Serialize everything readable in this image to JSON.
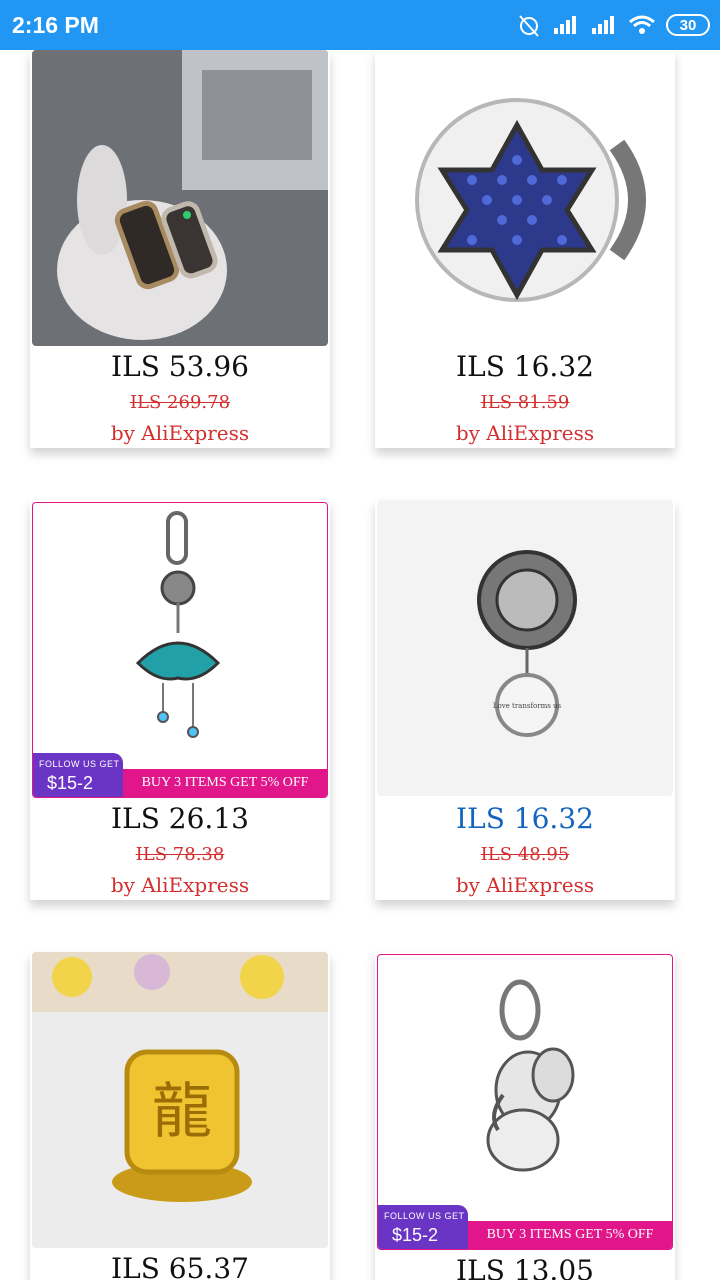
{
  "status_bar": {
    "time": "2:16 PM",
    "battery": "30"
  },
  "products": [
    {
      "price": "ILS 53.96",
      "old_price": "ILS 269.78",
      "seller": "by AliExpress",
      "highlight": false
    },
    {
      "price": "ILS 16.32",
      "old_price": "ILS 81.59",
      "seller": "by AliExpress",
      "highlight": false
    },
    {
      "price": "ILS 26.13",
      "old_price": "ILS 78.38",
      "seller": "by AliExpress",
      "highlight": false,
      "promo": {
        "follow": "FOLLOW US GET",
        "amount": "$15-2",
        "offer": "BUY 3 ITEMS GET 5% OFF"
      }
    },
    {
      "price": "ILS 16.32",
      "old_price": "ILS 48.95",
      "seller": "by AliExpress",
      "highlight": true,
      "charm_text": "Love transforms us"
    },
    {
      "price": "ILS 65.37"
    },
    {
      "price": "ILS 13.05",
      "promo": {
        "follow": "FOLLOW US GET",
        "amount": "$15-2",
        "offer": "BUY 3 ITEMS GET 5% OFF"
      }
    }
  ]
}
